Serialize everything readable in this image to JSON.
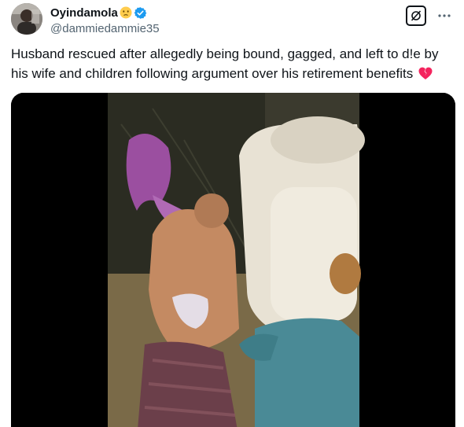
{
  "author": {
    "display_name": "Oyindamola",
    "handle": "@dammiedammie35",
    "emoji": "face-with-open-mouth",
    "verified": true,
    "avatar_icon": "user-avatar"
  },
  "tweet": {
    "text": "Husband rescued after allegedly being bound, gagged, and left to d!e by his wife and children following argument over his retirement benefits",
    "trailing_emoji": "broken-heart"
  },
  "actions": {
    "grok_icon": "grok-icon",
    "more_icon": "more-dots-icon"
  },
  "media": {
    "type": "video-still",
    "description_icon": "video-thumbnail"
  },
  "colors": {
    "text": "#0f1419",
    "secondary": "#536471",
    "verified": "#1d9bf0",
    "media_bg": "#000000",
    "heart": "#f4245e"
  }
}
